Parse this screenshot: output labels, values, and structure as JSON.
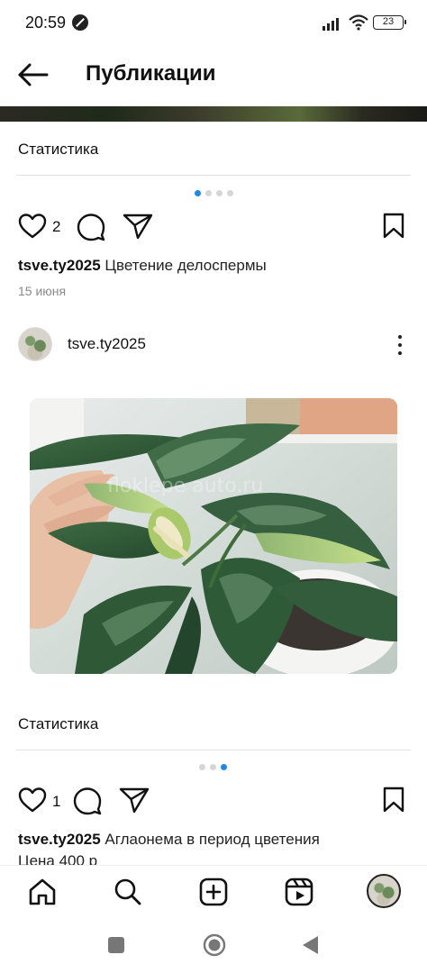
{
  "status_bar": {
    "time": "20:59",
    "battery": "23"
  },
  "header": {
    "title": "Публикации"
  },
  "post1": {
    "stats_label": "Статистика",
    "likes": "2",
    "username": "tsve.ty2025",
    "caption": "Цветение делоспермы",
    "date": "15 июня"
  },
  "post2": {
    "username": "tsve.ty2025",
    "watermark": "floklepe auto.ru",
    "stats_label": "Статистика",
    "likes": "1",
    "caption_user": "tsve.ty2025",
    "caption": "Аглаонема в период цветения",
    "caption_line2": "Цена 400 р"
  },
  "icons": {
    "back": "arrow-left-icon",
    "like": "heart-icon",
    "comment": "comment-icon",
    "share": "send-icon",
    "save": "bookmark-icon",
    "more": "more-vertical-icon",
    "home": "home-icon",
    "search": "search-icon",
    "create": "plus-square-icon",
    "reels": "reels-icon"
  },
  "colors": {
    "accent_dot": "#1e88e5",
    "text": "#111111",
    "muted": "#8a8a8a"
  }
}
